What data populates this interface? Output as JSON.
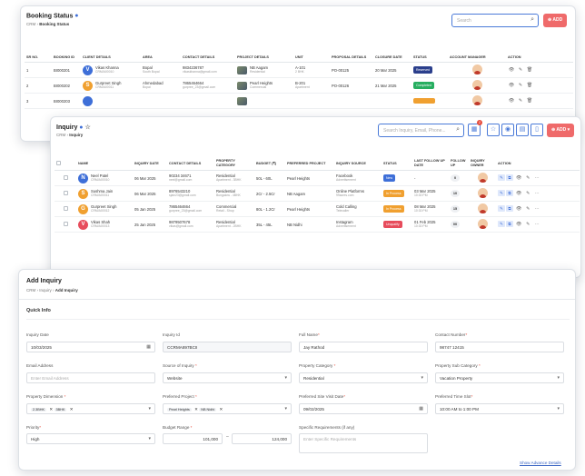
{
  "booking": {
    "title": "Booking Status",
    "crumb_root": "CRM",
    "crumb_current": "Booking Status",
    "search_placeholder": "Search",
    "add_label": "ADD",
    "columns": [
      "SR NO.",
      "BOOKING ID",
      "CLIENT DETAILS",
      "AREA",
      "CONTACT DETAILS",
      "PROJECT DETAILS",
      "UNIT",
      "PROPOSAL DETAILS",
      "CLOSURE DATE",
      "STATUS",
      "ACCOUNT MANAGER",
      "ACTION"
    ],
    "rows": [
      {
        "sr": "1",
        "id": "BI000201",
        "initial": "V",
        "color": "#3e6fd8",
        "name": "Vikas Khanna",
        "code": "CRM/A00010",
        "area": "Bopal",
        "area_sub": "South Bopal",
        "phone": "9834236787",
        "email": "vikaskhanna@gmail.com",
        "project": "NB Aagam",
        "project_sub": "Residential",
        "unit": "A-101",
        "unit_sub": "2 BHK",
        "proposal": "PO-00125",
        "date": "20 Mar 2025",
        "status": "Reserved",
        "status_color": "#2b3f8c"
      },
      {
        "sr": "2",
        "id": "BI000202",
        "initial": "S",
        "color": "#f0a030",
        "name": "Gurpreet Singh",
        "code": "CRM/A00011",
        "area": "Ahmedabad",
        "area_sub": "Bopal",
        "phone": "7865464664",
        "email": "gurpree_23@gmail.com",
        "project": "Pearl Heights",
        "project_sub": "Commercial",
        "unit": "B-201",
        "unit_sub": "Apartment",
        "proposal": "PO-00126",
        "date": "21 Mar 2025",
        "status": "Completed",
        "status_color": "#27ae60"
      },
      {
        "sr": "3",
        "id": "BI000203",
        "initial": "",
        "color": "#3e6fd8",
        "name": "",
        "code": "",
        "area": "",
        "area_sub": "",
        "phone": "",
        "email": "",
        "project": "",
        "project_sub": "",
        "unit": "",
        "unit_sub": "",
        "proposal": "",
        "date": "",
        "status": "",
        "status_color": "#f0a030"
      }
    ]
  },
  "inquiry": {
    "title": "Inquiry",
    "crumb_root": "CRM",
    "crumb_current": "Inquiry",
    "search_placeholder": "Search Inquiry, Email, Phone...",
    "add_label": "ADD",
    "notif_count": "2",
    "columns": [
      "",
      "NAME",
      "INQUIRY DATE",
      "CONTACT DETAILS",
      "PROPERTY CATEGORY",
      "BUDGET (₹)",
      "PREFERRED PROJECT",
      "INQUIRY SOURCE",
      "STATUS",
      "LAST FOLLOW UP DATE",
      "FOLLOW UP",
      "INQUIRY OWNER",
      "ACTION"
    ],
    "rows": [
      {
        "initial": "N",
        "color": "#3e6fd8",
        "name": "Neel Patel",
        "code": "CRM/A00010",
        "date": "06 Mar 2025",
        "phone": "90234 34671",
        "email": "neel@gmail.com",
        "cat": "Residential",
        "cat_sub": "Apartment - 3BHK",
        "budget": "50L - 60L",
        "project": "Pearl Heights",
        "source": "Facebook",
        "source_sub": "Advertisement",
        "status": "New",
        "status_color": "#3e6fd8",
        "lfu": "-",
        "lfu_time": "",
        "fu": "0"
      },
      {
        "initial": "S",
        "color": "#f0a030",
        "name": "Sushma Jain",
        "code": "CRM/A00011",
        "date": "06 Mar 2025",
        "phone": "8976543210",
        "email": "sjain23@gmail.com",
        "cat": "Residential",
        "cat_sub": "Bungalow - 4BHK",
        "budget": "2Cr - 2.5Cr",
        "project": "NB Aagam",
        "source": "Online Platforms",
        "source_sub": "99acres.com",
        "status": "In Process",
        "status_color": "#f0a030",
        "lfu": "03 Mar 2025",
        "lfu_time": "10:30 PM",
        "fu": "10"
      },
      {
        "initial": "G",
        "color": "#f0a030",
        "name": "Gurpreet Singh",
        "code": "CRM/A00012",
        "date": "05 Jan 2025",
        "phone": "7865464664",
        "email": "gurpree_23@gmail.com",
        "cat": "Commercial",
        "cat_sub": "Retail - Shop",
        "budget": "80L - 1.2Cr",
        "project": "Pearl Heights",
        "source": "Cold Calling",
        "source_sub": "Telecaller",
        "status": "In Process",
        "status_color": "#f0a030",
        "lfu": "08 Mar 2025",
        "lfu_time": "10:30 PM",
        "fu": "15"
      },
      {
        "initial": "V",
        "color": "#e74c5c",
        "name": "Vikas Shah",
        "code": "CRM/A00013",
        "date": "25 Jan 2025",
        "phone": "9879507678",
        "email": "vikas@gmail.com",
        "cat": "Residential",
        "cat_sub": "Apartment - 2BHK",
        "budget": "35L - 45L",
        "project": "NB Nidhi",
        "source": "Instagram",
        "source_sub": "Advertisement",
        "status": "Unqualify",
        "status_color": "#e74c5c",
        "lfu": "01 Feb 2025",
        "lfu_time": "10:30 PM",
        "fu": "00"
      }
    ]
  },
  "add": {
    "title": "Add Inquiry",
    "crumb_root": "CRM",
    "crumb_mid": "Inquiry",
    "crumb_current": "Add Inquiry",
    "section": "Quick Info",
    "f_date_label": "Inquiry Date",
    "f_date_value": "10/03/2025",
    "f_id_label": "Inquiry Id",
    "f_id_value": "CCRMA897BCII",
    "f_name_label": "Full Name",
    "f_name_value": "Jay Rathod",
    "f_contact_label": "Contact Number",
    "f_contact_value": "98747 12415",
    "f_email_label": "Email Address",
    "f_email_ph": "Enter Email Address",
    "f_source_label": "Source of Inquiry",
    "f_source_value": "Website",
    "f_cat_label": "Property Category",
    "f_cat_value": "Residential",
    "f_subcat_label": "Property Sub Category",
    "f_subcat_value": "Vacation Property",
    "f_dim_label": "Property Dimension",
    "f_dim_a": "2.3BHK",
    "f_dim_b": "3BHK",
    "f_proj_label": "Preferred Project",
    "f_proj_a": "Pearl Heights",
    "f_proj_b": "NB Nidhi",
    "f_visit_label": "Preferred Site Visit Date",
    "f_visit_value": "09/02/2025",
    "f_time_label": "Preferred Time Slot",
    "f_time_value": "10:00 AM to 1:00 PM",
    "f_prio_label": "Priority",
    "f_prio_value": "High",
    "f_budget_label": "Budget Range",
    "f_budget_min": "101,000",
    "f_budget_max": "124,000",
    "f_req_label": "Specific Requirements (if any)",
    "f_req_ph": "Enter Specific Requirements",
    "advance_link": "Show Advance Details"
  }
}
